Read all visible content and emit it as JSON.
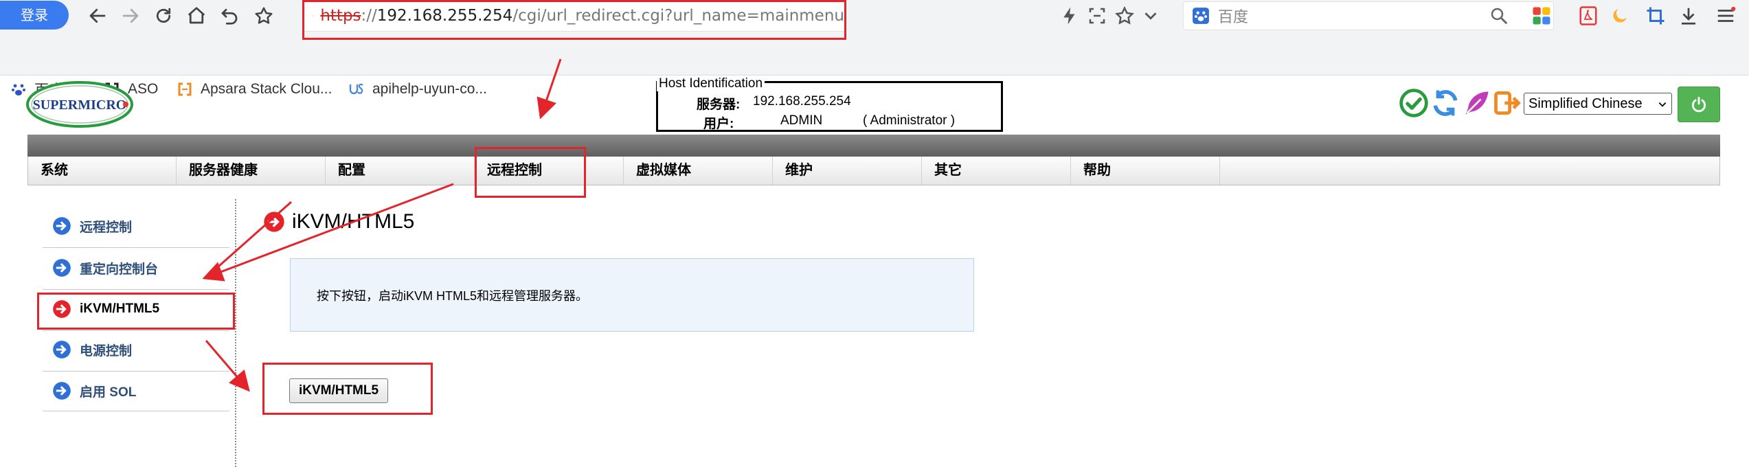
{
  "browser": {
    "login_label": "登录",
    "url": {
      "protocol": "https",
      "separator": "://",
      "host": "192.168.255.254",
      "path": "/cgi/url_redirect.cgi?url_name=mainmenu"
    },
    "search_placeholder": "百度",
    "bookmarks": [
      {
        "label": "百度一下",
        "icon": "paw-icon"
      },
      {
        "label": "ASO",
        "icon": "bracket-icon"
      },
      {
        "label": "Apsara Stack Clou...",
        "icon": "apsara-icon"
      },
      {
        "label": "apihelp-uyun-co...",
        "icon": "uyun-icon"
      }
    ]
  },
  "header": {
    "logo_text": "SUPERMICRO",
    "host": {
      "legend": "Host Identification",
      "server_label": "服务器:",
      "server_value": "192.168.255.254",
      "user_label": "用户:",
      "user_value": "ADMIN",
      "user_role": "( Administrator )"
    },
    "language_selected": "Simplified Chinese"
  },
  "nav": {
    "items": [
      "系统",
      "服务器健康",
      "配置",
      "远程控制",
      "虚拟媒体",
      "维护",
      "其它",
      "帮助"
    ]
  },
  "sidebar": {
    "items": [
      "远程控制",
      "重定向控制台",
      "iKVM/HTML5",
      "电源控制",
      "启用 SOL"
    ],
    "active_index": 2
  },
  "main": {
    "title": "iKVM/HTML5",
    "info_text": "按下按钮，启动iKVM HTML5和远程管理服务器。",
    "button_label": "iKVM/HTML5"
  },
  "colors": {
    "annotation": "#e3242b",
    "nav_text": "#000000",
    "sidebar_link": "#2e4f7a",
    "accent_blue": "#2f6fd6",
    "power_green": "#54b455"
  }
}
